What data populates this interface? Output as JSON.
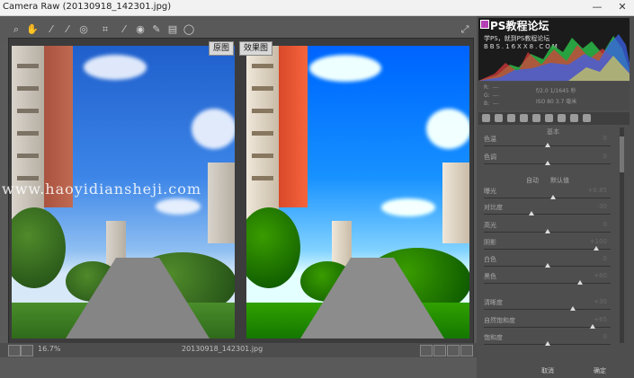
{
  "window": {
    "title": "Camera Raw (20130918_142301.jpg)",
    "minimize": "—",
    "close": "✕"
  },
  "toolbar": {
    "tools": [
      {
        "name": "zoom-tool-icon",
        "glyph": "⌕"
      },
      {
        "name": "hand-tool-icon",
        "glyph": "✋"
      },
      {
        "name": "white-balance-tool-icon",
        "glyph": "⁄"
      },
      {
        "name": "color-sampler-tool-icon",
        "glyph": "⁄"
      },
      {
        "name": "target-adjust-tool-icon",
        "glyph": "◎"
      },
      {
        "name": "crop-tool-icon",
        "glyph": "⌗"
      },
      {
        "name": "straighten-tool-icon",
        "glyph": "⁄"
      },
      {
        "name": "red-eye-tool-icon",
        "glyph": "◉"
      },
      {
        "name": "brush-tool-icon",
        "glyph": "✎"
      },
      {
        "name": "graduated-filter-icon",
        "glyph": "▤"
      },
      {
        "name": "radial-filter-icon",
        "glyph": "◯"
      }
    ],
    "fullscreen_glyph": "⤢"
  },
  "preview": {
    "before_label": "原图",
    "after_label": "效果图",
    "watermark": "www.haoyidiansheji.com"
  },
  "bottom": {
    "zoom": "16.7%",
    "filename": "20130918_142301.jpg"
  },
  "histogram": {
    "brand_title": "PS教程论坛",
    "brand_subtitle": "学PS，就到PS教程论坛",
    "brand_url": "BBS.16XX8.COM"
  },
  "info": {
    "r": "R:",
    "g": "G:",
    "b": "B:",
    "dash": "---",
    "aperture_shutter": "f/2.0  1/1645 秒",
    "iso_focal": "ISO 80  3.7 毫米"
  },
  "panel": {
    "section_title": "基本",
    "subhead_left": "自动",
    "subhead_right": "默认值",
    "sliders": [
      {
        "label": "色温",
        "value": "0"
      },
      {
        "label": "色调",
        "value": "0"
      },
      {
        "label": "曝光",
        "value": "+0.85"
      },
      {
        "label": "对比度",
        "value": "-30"
      },
      {
        "label": "高光",
        "value": "0"
      },
      {
        "label": "阴影",
        "value": "+100"
      },
      {
        "label": "白色",
        "value": "0"
      },
      {
        "label": "黑色",
        "value": "+60"
      },
      {
        "label": "清晰度",
        "value": "+30"
      },
      {
        "label": "自然饱和度",
        "value": "+65"
      },
      {
        "label": "饱和度",
        "value": "0"
      }
    ],
    "cancel": "取消",
    "done": "确定"
  },
  "colors": {
    "accent": "#b43fb4",
    "panel_bg": "#4e4e4e"
  }
}
